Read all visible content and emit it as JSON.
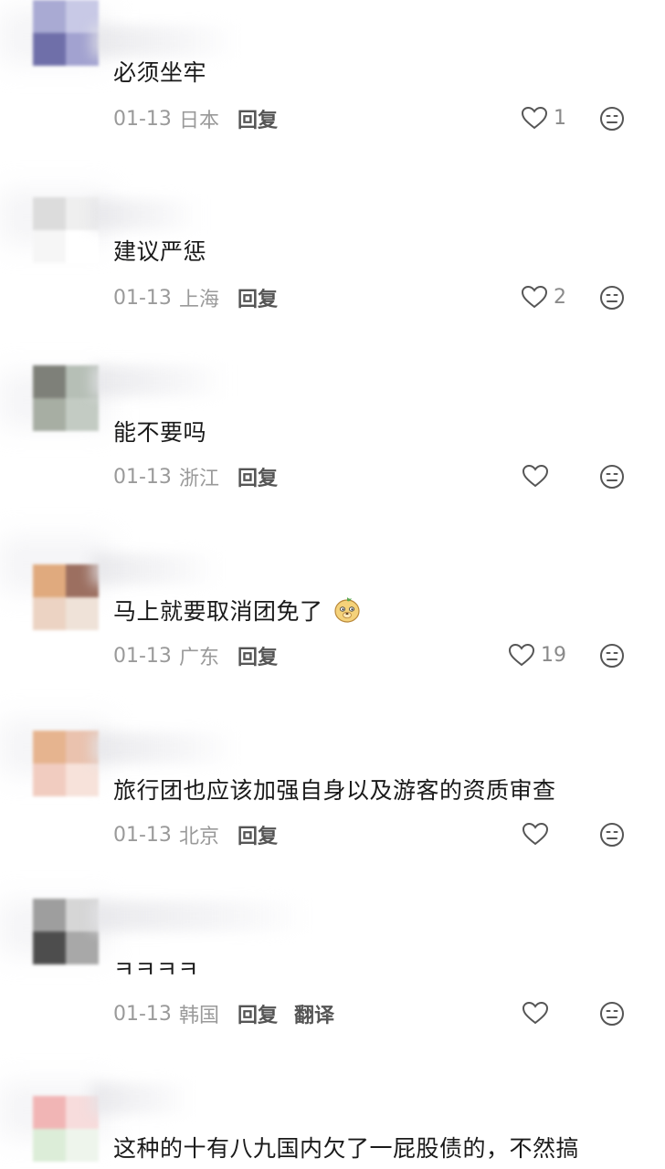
{
  "comments": [
    {
      "text": "必须坐牢",
      "date": "01-13",
      "location": "日本",
      "reply": "回复",
      "likes": "1",
      "avatar_colors": [
        "#a9aad3",
        "#c8c9e6",
        "#6f6fa9",
        "#a2a2d0"
      ]
    },
    {
      "text": "建议严惩",
      "date": "01-13",
      "location": "上海",
      "reply": "回复",
      "likes": "2",
      "avatar_colors": [
        "#dcdcdc",
        "#efefef",
        "#f6f6f6",
        "#ffffff"
      ]
    },
    {
      "text": "能不要吗",
      "date": "01-13",
      "location": "浙江",
      "reply": "回复",
      "likes": "",
      "avatar_colors": [
        "#7e8079",
        "#b6bfb6",
        "#a7aea3",
        "#c3cbc3"
      ]
    },
    {
      "text": "马上就要取消团免了",
      "date": "01-13",
      "location": "广东",
      "reply": "回复",
      "likes": "19",
      "avatar_colors": [
        "#e0aa7e",
        "#9c6f60",
        "#ecd3c3",
        "#efe2d8"
      ],
      "emoji": "doge-face-icon"
    },
    {
      "text": "旅行团也应该加强自身以及游客的资质审查",
      "date": "01-13",
      "location": "北京",
      "reply": "回复",
      "likes": "",
      "avatar_colors": [
        "#e6b48f",
        "#eac2ae",
        "#f1ccc0",
        "#f7e2da"
      ]
    },
    {
      "text": "ㅋㅋㅋㅋ",
      "date": "01-13",
      "location": "韩国",
      "reply": "回复",
      "translate": "翻译",
      "likes": "",
      "avatar_colors": [
        "#9e9e9e",
        "#d6d6d6",
        "#4d4d4d",
        "#a8a8a8"
      ]
    },
    {
      "text": "这种的十有八九国内欠了一屁股债的，不然搞",
      "date": "",
      "location": "",
      "reply": "",
      "likes": "",
      "avatar_colors": [
        "#f1b5b5",
        "#f7dcdc",
        "#dcedd8",
        "#eef5ec"
      ]
    }
  ],
  "icons": {
    "like": "heart-outline-icon",
    "reaction": "meh-face-icon"
  }
}
